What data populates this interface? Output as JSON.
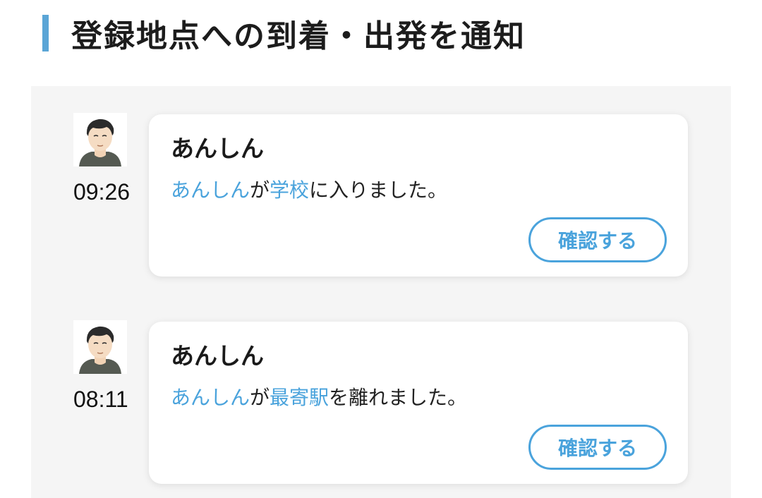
{
  "section": {
    "title": "登録地点への到着・出発を通知"
  },
  "notifications": [
    {
      "time": "09:26",
      "name": "あんしん",
      "message": {
        "subject": "あんしん",
        "particle": "が",
        "place": "学校",
        "rest": "に入りました。"
      },
      "button_label": "確認する"
    },
    {
      "time": "08:11",
      "name": "あんしん",
      "message": {
        "subject": "あんしん",
        "particle": "が",
        "place": "最寄駅",
        "rest": "を離れました。"
      },
      "button_label": "確認する"
    }
  ],
  "colors": {
    "accent_bar": "#5aa5d6",
    "link": "#4aa3dc",
    "panel_bg": "#f5f5f5"
  }
}
